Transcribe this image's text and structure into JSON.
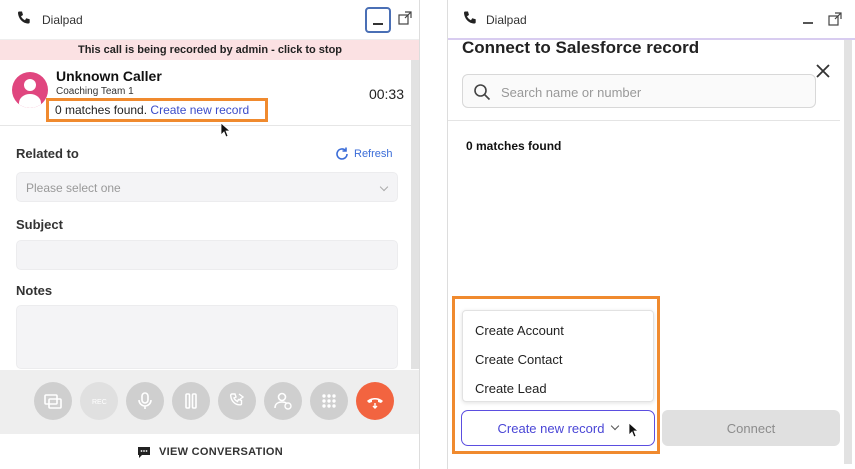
{
  "left_panel": {
    "titlebar": {
      "title": "Dialpad"
    },
    "recording_banner": "This call is being recorded by admin - click to stop",
    "caller": {
      "name": "Unknown Caller",
      "team": "Coaching Team 1",
      "matches_text": "0 matches found.",
      "create_link": "Create new record",
      "timer": "00:33"
    },
    "form": {
      "related_to_label": "Related to",
      "refresh_label": "Refresh",
      "related_placeholder": "Please select one",
      "subject_label": "Subject",
      "notes_label": "Notes"
    },
    "call_controls": [
      "transfer-screen-icon",
      "keypad-icon",
      "mute-icon",
      "hold-icon",
      "forward-call-icon",
      "add-person-icon",
      "dialpad-grid-icon",
      "end-call-icon"
    ],
    "view_conversation": "VIEW CONVERSATION"
  },
  "right_panel": {
    "titlebar": {
      "title": "Dialpad"
    },
    "modal_title": "Connect to Salesforce record",
    "search_placeholder": "Search name or number",
    "matches_text": "0 matches found",
    "dropdown_items": [
      "Create Account",
      "Create Contact",
      "Create Lead"
    ],
    "create_button": "Create new record",
    "connect_button": "Connect"
  },
  "colors": {
    "highlight_orange": "#f08a2e",
    "recording_banner_bg": "#fbe1e3",
    "end_call_red": "#f26440",
    "link_blue": "#3b4cc9",
    "avatar_pink": "#e0467f",
    "create_button_purple": "#5b4ee0"
  }
}
